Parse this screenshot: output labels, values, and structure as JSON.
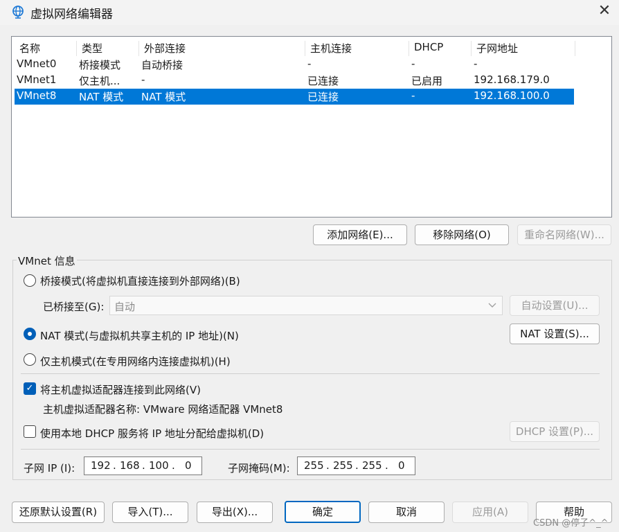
{
  "window": {
    "title": "虚拟网络编辑器",
    "close_label": "✕"
  },
  "network_list": {
    "headers": [
      "名称",
      "类型",
      "外部连接",
      "主机连接",
      "DHCP",
      "子网地址"
    ],
    "rows": [
      [
        "VMnet0",
        "桥接模式",
        "自动桥接",
        "-",
        "-",
        "-"
      ],
      [
        "VMnet1",
        "仅主机...",
        "-",
        "已连接",
        "已启用",
        "192.168.179.0"
      ],
      [
        "VMnet8",
        "NAT 模式",
        "NAT 模式",
        "已连接",
        "-",
        "192.168.100.0"
      ]
    ],
    "selected_index": 2,
    "selection_color": "#0078d7"
  },
  "list_buttons": {
    "add": "添加网络(E)...",
    "remove": "移除网络(O)",
    "rename": "重命名网络(W)..."
  },
  "vmnet_info": {
    "group_title": "VMnet 信息",
    "bridged_label": "桥接模式(将虚拟机直接连接到外部网络)(B)",
    "bridged_to_label": "已桥接至(G):",
    "bridged_to_value": "自动",
    "auto_settings": "自动设置(U)...",
    "nat_label": "NAT 模式(与虚拟机共享主机的 IP 地址)(N)",
    "nat_settings": "NAT 设置(S)...",
    "hostonly_label": "仅主机模式(在专用网络内连接虚拟机)(H)",
    "mode_selected": "nat",
    "connect_adapter_label": "将主机虚拟适配器连接到此网络(V)",
    "connect_adapter_checked": true,
    "adapter_name_text": "主机虚拟适配器名称: VMware 网络适配器 VMnet8",
    "dhcp_label": "使用本地 DHCP 服务将 IP 地址分配给虚拟机(D)",
    "dhcp_checked": false,
    "dhcp_settings": "DHCP 设置(P)...",
    "subnet_ip_label": "子网 IP (I):",
    "subnet_ip": [
      "192",
      "168",
      "100",
      "0"
    ],
    "subnet_mask_label": "子网掩码(M):",
    "subnet_mask": [
      "255",
      "255",
      "255",
      "0"
    ]
  },
  "footer": {
    "restore": "还原默认设置(R)",
    "import": "导入(T)...",
    "export": "导出(X)...",
    "ok": "确定",
    "cancel": "取消",
    "apply": "应用(A)",
    "help": "帮助"
  },
  "watermark": "CSDN @停子^_^",
  "colors": {
    "accent": "#005fb8",
    "selection": "#0078d7"
  }
}
